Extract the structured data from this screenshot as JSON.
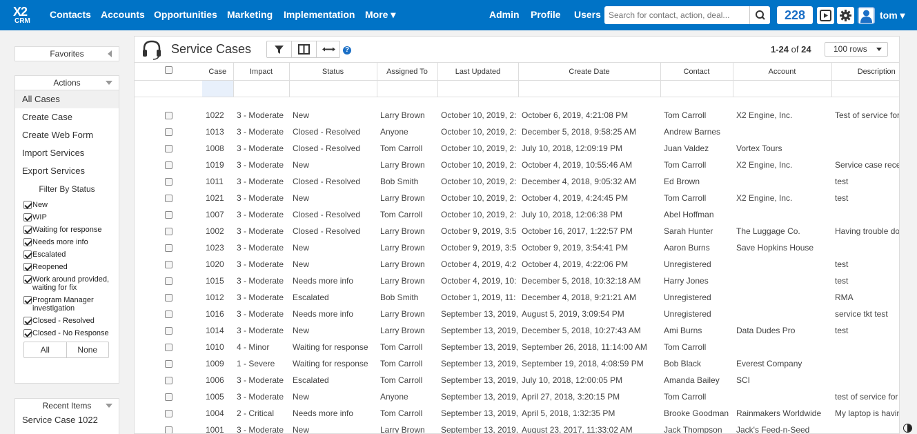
{
  "app": {
    "logo_line1": "X2",
    "logo_line2": "CRM"
  },
  "nav": {
    "contacts": "Contacts",
    "accounts": "Accounts",
    "opportunities": "Opportunities",
    "marketing": "Marketing",
    "implementation": "Implementation",
    "more": "More ▾",
    "admin": "Admin",
    "profile": "Profile",
    "users": "Users",
    "search_placeholder": "Search for contact, action, deal...",
    "notification_count": "228",
    "user_label": "tom ▾"
  },
  "sidebar": {
    "favorites_title": "Favorites",
    "actions_title": "Actions",
    "actions": [
      "All Cases",
      "Create Case",
      "Create Web Form",
      "Import Services",
      "Export Services"
    ],
    "filter_title": "Filter By Status",
    "filters": [
      "New",
      "WIP",
      "Waiting for response",
      "Needs more info",
      "Escalated",
      "Reopened",
      "Work around provided, waiting for fix",
      "Program Manager investigation",
      "Closed - Resolved",
      "Closed - No Response"
    ],
    "all_label": "All",
    "none_label": "None",
    "recent_title": "Recent Items",
    "recent_items": [
      "Service Case 1022"
    ]
  },
  "main": {
    "title": "Service Cases",
    "pager_range": "1-24",
    "pager_of": "of",
    "pager_total": "24",
    "rows_per_page": "100 rows",
    "help": "?",
    "columns": [
      "Case",
      "Impact",
      "Status",
      "Assigned To",
      "Last Updated",
      "Create Date",
      "Contact",
      "Account",
      "Description"
    ],
    "rows": [
      [
        "1022",
        "3 - Moderate",
        "New",
        "Larry Brown",
        "October 10, 2019, 2:",
        "October 6, 2019, 4:21:08 PM",
        "Tom Carroll",
        "X2 Engine, Inc.",
        "Test of service for"
      ],
      [
        "1013",
        "3 - Moderate",
        "Closed - Resolved",
        "Anyone",
        "October 10, 2019, 2:",
        "December 5, 2018, 9:58:25 AM",
        "Andrew Barnes",
        "",
        ""
      ],
      [
        "1008",
        "3 - Moderate",
        "Closed - Resolved",
        "Tom Carroll",
        "October 10, 2019, 2:",
        "July 10, 2018, 12:09:19 PM",
        "Juan Valdez",
        "Vortex Tours",
        ""
      ],
      [
        "1019",
        "3 - Moderate",
        "New",
        "Larry Brown",
        "October 10, 2019, 2:",
        "October 4, 2019, 10:55:46 AM",
        "Tom Carroll",
        "X2 Engine, Inc.",
        "Service case rece"
      ],
      [
        "1011",
        "3 - Moderate",
        "Closed - Resolved",
        "Bob Smith",
        "October 10, 2019, 2:",
        "December 4, 2018, 9:05:32 AM",
        "Ed Brown",
        "",
        "test"
      ],
      [
        "1021",
        "3 - Moderate",
        "New",
        "Larry Brown",
        "October 10, 2019, 2:",
        "October 4, 2019, 4:24:45 PM",
        "Tom Carroll",
        "X2 Engine, Inc.",
        "test"
      ],
      [
        "1007",
        "3 - Moderate",
        "Closed - Resolved",
        "Tom Carroll",
        "October 10, 2019, 2:",
        "July 10, 2018, 12:06:38 PM",
        "Abel Hoffman",
        "",
        ""
      ],
      [
        "1002",
        "3 - Moderate",
        "Closed - Resolved",
        "Larry Brown",
        "October 9, 2019, 3:5",
        "October 16, 2017, 1:22:57 PM",
        "Sarah Hunter",
        "The Luggage Co.",
        "Having trouble do"
      ],
      [
        "1023",
        "3 - Moderate",
        "New",
        "Larry Brown",
        "October 9, 2019, 3:5",
        "October 9, 2019, 3:54:41 PM",
        "Aaron Burns",
        "Save Hopkins House",
        ""
      ],
      [
        "1020",
        "3 - Moderate",
        "New",
        "Larry Brown",
        "October 4, 2019, 4:2",
        "October 4, 2019, 4:22:06 PM",
        "Unregistered",
        "",
        "test"
      ],
      [
        "1015",
        "3 - Moderate",
        "Needs more info",
        "Larry Brown",
        "October 4, 2019, 10:",
        "December 5, 2018, 10:32:18 AM",
        "Harry Jones",
        "",
        "test"
      ],
      [
        "1012",
        "3 - Moderate",
        "Escalated",
        "Bob Smith",
        "October 1, 2019, 11:",
        "December 4, 2018, 9:21:21 AM",
        "Unregistered",
        "",
        "RMA"
      ],
      [
        "1016",
        "3 - Moderate",
        "Needs more info",
        "Larry Brown",
        "September 13, 2019,",
        "August 5, 2019, 3:09:54 PM",
        "Unregistered",
        "",
        "service tkt test"
      ],
      [
        "1014",
        "3 - Moderate",
        "New",
        "Larry Brown",
        "September 13, 2019,",
        "December 5, 2018, 10:27:43 AM",
        "Ami Burns",
        "Data Dudes Pro",
        "test"
      ],
      [
        "1010",
        "4 - Minor",
        "Waiting for response",
        "Tom Carroll",
        "September 13, 2019,",
        "September 26, 2018, 11:14:00 AM",
        "Tom Carroll",
        "",
        ""
      ],
      [
        "1009",
        "1 - Severe",
        "Waiting for response",
        "Tom Carroll",
        "September 13, 2019,",
        "September 19, 2018, 4:08:59 PM",
        "Bob Black",
        "Everest Company",
        ""
      ],
      [
        "1006",
        "3 - Moderate",
        "Escalated",
        "Tom Carroll",
        "September 13, 2019,",
        "July 10, 2018, 12:00:05 PM",
        "Amanda Bailey",
        "SCI",
        ""
      ],
      [
        "1005",
        "3 - Moderate",
        "New",
        "Anyone",
        "September 13, 2019,",
        "April 27, 2018, 3:20:15 PM",
        "Tom Carroll",
        "",
        "test of service for"
      ],
      [
        "1004",
        "2 - Critical",
        "Needs more info",
        "Tom Carroll",
        "September 13, 2019,",
        "April 5, 2018, 1:32:35 PM",
        "Brooke Goodman",
        "Rainmakers Worldwide",
        "My laptop is havin"
      ],
      [
        "1001",
        "3 - Moderate",
        "New",
        "Larry Brown",
        "September 13, 2019,",
        "August 23, 2017, 11:33:02 AM",
        "Jack Thompson",
        "Jack's Feed-n-Seed",
        ""
      ]
    ]
  },
  "colors": {
    "topbar": "#0073c6",
    "accent": "#1b6fc6"
  },
  "icons": {
    "search": "search-icon",
    "media": "media-icon",
    "settings": "gear-icon",
    "avatar": "avatar-icon",
    "headset": "headset-icon",
    "filter": "filter-icon",
    "columns": "columns-icon",
    "resize": "resize-icon"
  }
}
